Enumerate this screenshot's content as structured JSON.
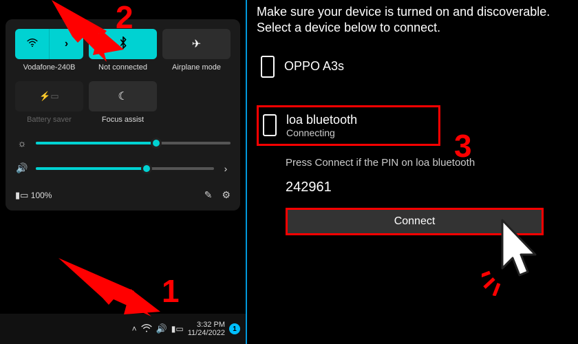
{
  "left": {
    "tiles": {
      "wifi": {
        "label": "Vodafone-240B",
        "active": true
      },
      "bt": {
        "label": "Not connected",
        "active": true
      },
      "air": {
        "label": "Airplane mode",
        "active": false
      },
      "batt": {
        "label": "Battery saver",
        "disabled": true
      },
      "focus": {
        "label": "Focus assist",
        "active": false
      }
    },
    "brightness_pct": 62,
    "volume_pct": 62,
    "battery_text": "100%",
    "taskbar": {
      "time": "3:32 PM",
      "date": "11/24/2022",
      "badge": "1"
    }
  },
  "right": {
    "instruction": "Make sure your device is turned on and discoverable. Select a device below to connect.",
    "devices": [
      {
        "name": "OPPO A3s",
        "status": ""
      },
      {
        "name": "loa bluetooth",
        "status": "Connecting"
      }
    ],
    "pin_prompt": "Press Connect if the PIN on loa bluetooth",
    "pin": "242961",
    "connect_label": "Connect"
  },
  "annotations": {
    "step1": "1",
    "step2": "2",
    "step3": "3"
  }
}
